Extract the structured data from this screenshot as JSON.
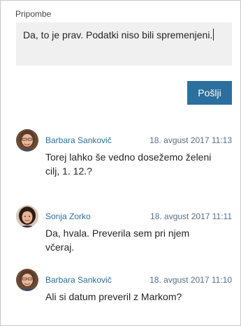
{
  "comment_form": {
    "label": "Pripombe",
    "input_value": "Da, to je prav. Podatki niso bili spremenjeni.",
    "send_label": "Pošlji"
  },
  "comments": [
    {
      "author": "Barbara Sankovič",
      "timestamp": "18. avgust 2017 11:13",
      "text": "Torej lahko še vedno dosežemo želeni cilj, 1. 12.?",
      "avatar": "avatar-barbara"
    },
    {
      "author": "Sonja Zorko",
      "timestamp": "18. avgust 2017 11:11",
      "text": "Da, hvala. Preverila sem pri njem včeraj.",
      "avatar": "avatar-sonja"
    },
    {
      "author": "Barbara Sankovič",
      "timestamp": "18. avgust 2017 11:10",
      "text": "Ali si datum preveril z Markom?",
      "avatar": "avatar-barbara"
    }
  ],
  "colors": {
    "accent": "#2b6f9e",
    "author": "#2b6f9e",
    "timestamp": "#5a6f84",
    "input_background": "#f0f0f0"
  }
}
